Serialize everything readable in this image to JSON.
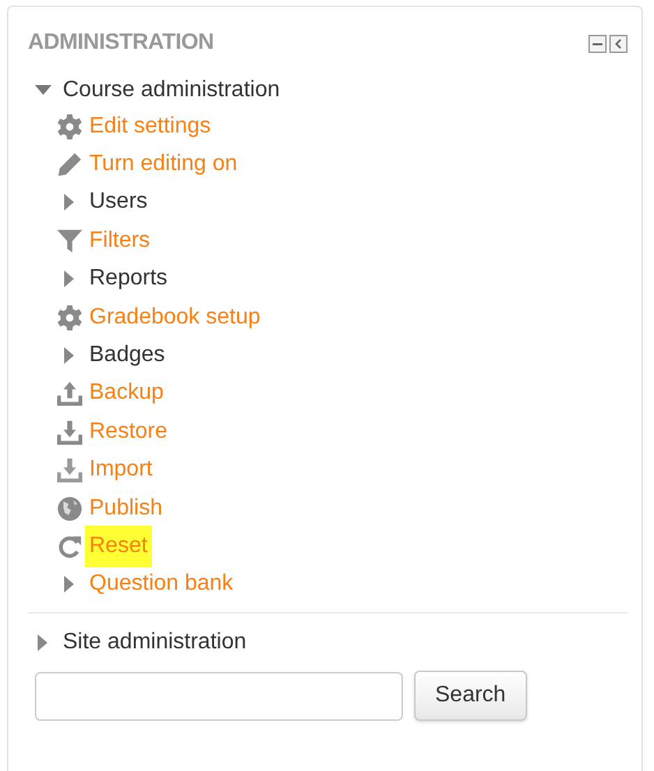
{
  "block": {
    "title": "ADMINISTRATION"
  },
  "course_admin": {
    "label": "Course administration",
    "expanded": true,
    "children": [
      {
        "label": "Edit settings",
        "kind": "settings",
        "link": true,
        "highlighted": false
      },
      {
        "label": "Turn editing on",
        "kind": "edit",
        "link": true,
        "highlighted": false
      },
      {
        "label": "Users",
        "kind": "branch",
        "link": false,
        "highlighted": false
      },
      {
        "label": "Filters",
        "kind": "filter",
        "link": true,
        "highlighted": false
      },
      {
        "label": "Reports",
        "kind": "branch",
        "link": false,
        "highlighted": false
      },
      {
        "label": "Gradebook setup",
        "kind": "settings",
        "link": true,
        "highlighted": false
      },
      {
        "label": "Badges",
        "kind": "branch",
        "link": false,
        "highlighted": false
      },
      {
        "label": "Backup",
        "kind": "upload",
        "link": true,
        "highlighted": false
      },
      {
        "label": "Restore",
        "kind": "download",
        "link": true,
        "highlighted": false
      },
      {
        "label": "Import",
        "kind": "download-light",
        "link": true,
        "highlighted": false
      },
      {
        "label": "Publish",
        "kind": "globe",
        "link": true,
        "highlighted": false
      },
      {
        "label": "Reset",
        "kind": "reset",
        "link": true,
        "highlighted": true
      },
      {
        "label": "Question bank",
        "kind": "branch",
        "link": true,
        "highlighted": false
      }
    ]
  },
  "site_admin": {
    "label": "Site administration",
    "expanded": false
  },
  "search": {
    "button": "Search"
  }
}
